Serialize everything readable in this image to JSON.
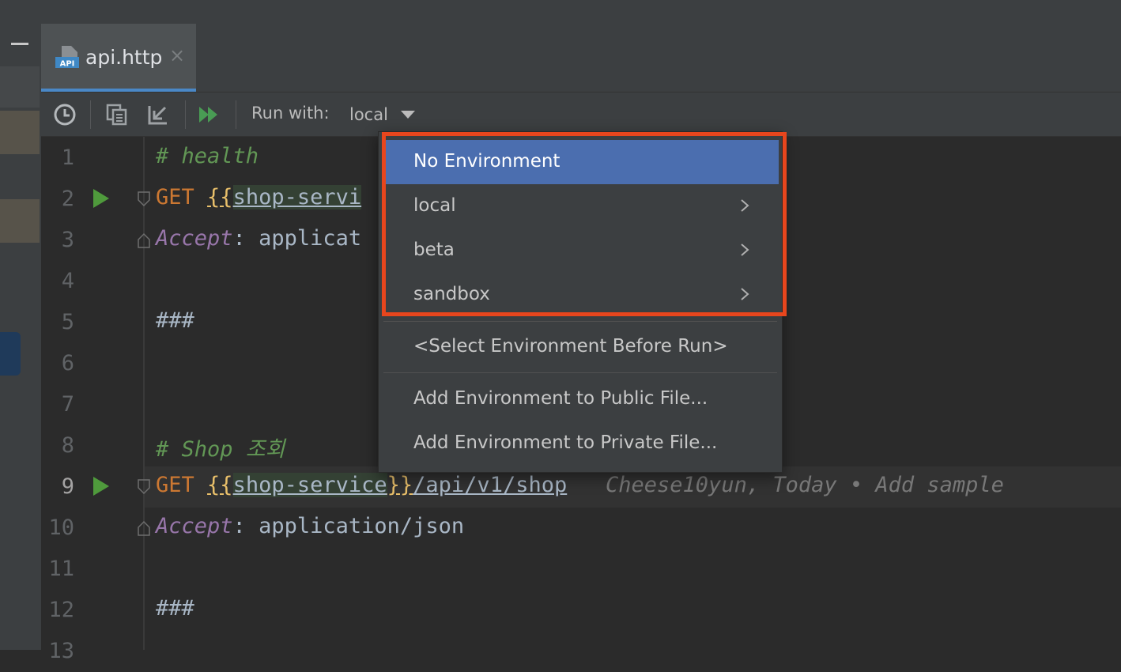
{
  "tab": {
    "title": "api.http",
    "close": "×",
    "icon_text": "API"
  },
  "toolbar": {
    "run_with_label": "Run with:",
    "env_value": "local"
  },
  "editor": {
    "line_numbers": [
      "1",
      "2",
      "3",
      "4",
      "5",
      "6",
      "7",
      "8",
      "9",
      "10",
      "11",
      "12",
      "13"
    ],
    "line1": {
      "comment": "# health"
    },
    "line2": {
      "method": "GET",
      "brace_open": "{{",
      "var": "shop-servi"
    },
    "line3": {
      "header": "Accept",
      "colon": ":",
      "value": " applicat"
    },
    "line5": {
      "sep": "###"
    },
    "line8": {
      "comment": "# Shop 조회"
    },
    "line9": {
      "method": "GET",
      "brace_open": "{{",
      "var": "shop-service",
      "brace_close": "}}",
      "path": "/api/v1/shop",
      "blame": "Cheese10yun, Today • Add sample"
    },
    "line10": {
      "header": "Accept",
      "colon": ":",
      "value": " application/json"
    },
    "line12": {
      "sep": "###"
    }
  },
  "env_menu": {
    "items": [
      {
        "label": "No Environment"
      },
      {
        "label": "local"
      },
      {
        "label": "beta"
      },
      {
        "label": "sandbox"
      },
      {
        "label": "<Select Environment Before Run>"
      },
      {
        "label": "Add Environment to Public File..."
      },
      {
        "label": "Add Environment to Private File..."
      }
    ],
    "selected": "No Environment"
  },
  "colors": {
    "accent_selection": "#4b6eaf",
    "highlight_box": "#e8461d",
    "run_icon": "#4f9a3c",
    "tab_underline": "#4a88c7"
  }
}
